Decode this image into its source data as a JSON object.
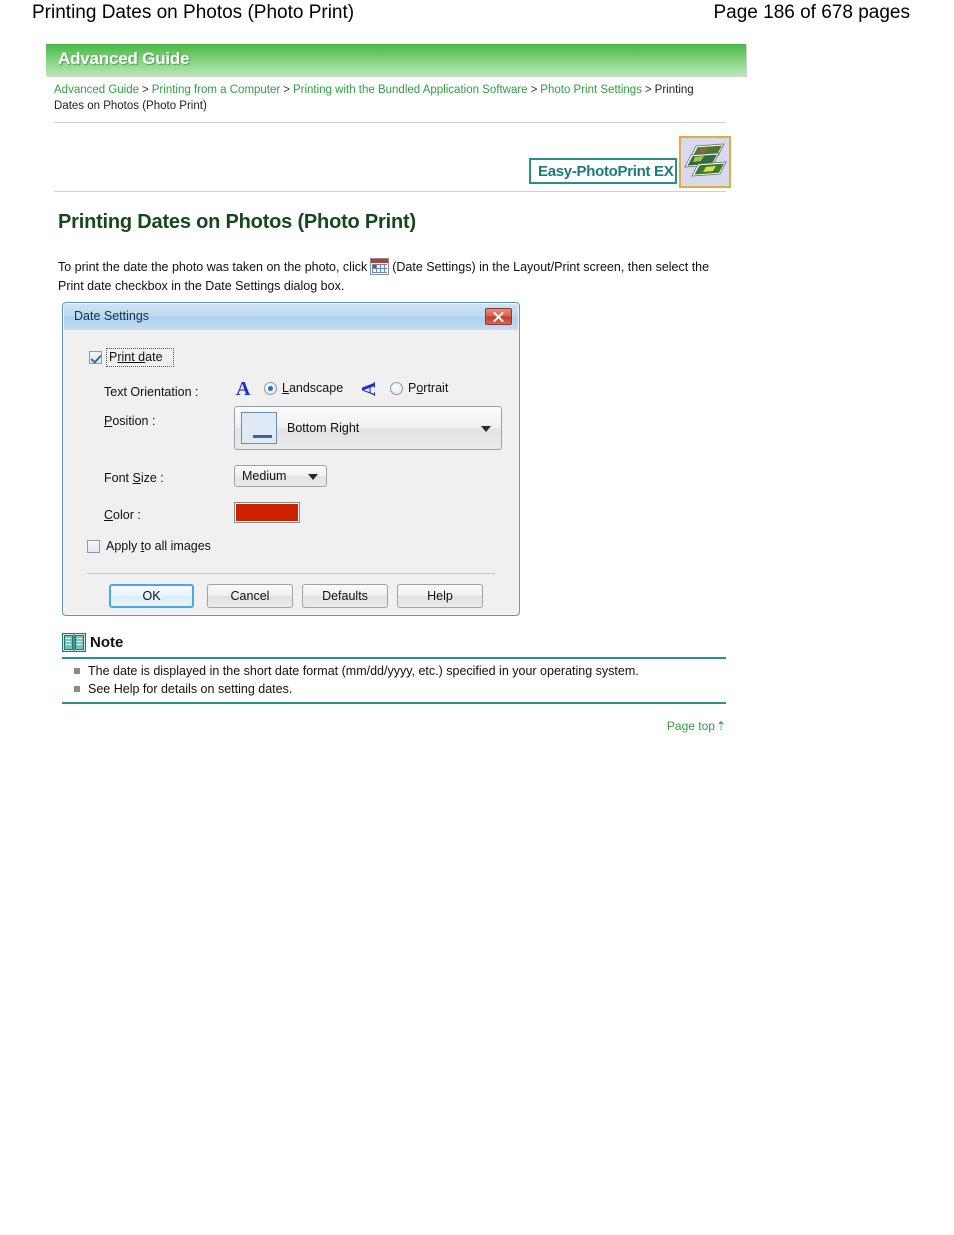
{
  "page": {
    "header_title": "Printing Dates on Photos (Photo Print)",
    "page_indicator": "Page 186 of 678 pages"
  },
  "guide_banner": {
    "label": "Advanced Guide",
    "gradient_top": "#4cb749",
    "gradient_bottom": "#b7e8b3"
  },
  "breadcrumb": {
    "items": [
      {
        "label": "Advanced Guide",
        "link": true
      },
      {
        "label": "Printing from a Computer",
        "link": true
      },
      {
        "label": "Printing with the Bundled Application Software",
        "link": true
      },
      {
        "label": "Photo Print Settings",
        "link": true
      },
      {
        "label": "Printing Dates on Photos (Photo Print)",
        "link": false
      }
    ],
    "separator": ">",
    "link_color": "#2f9e42"
  },
  "product_logo": {
    "badge_text": "Easy-PhotoPrint EX",
    "badge_border_color": "#2b8c8c",
    "badge_text_color": "#1d7a7a",
    "thumbnail_name": "photo-stack-icon",
    "thumbnail_border_color": "#e0ad3c"
  },
  "main": {
    "heading": "Printing Dates on Photos (Photo Print)",
    "heading_color": "#14491b",
    "paragraph_part1": "To print the date the photo was taken on the photo, click",
    "paragraph_icon_name": "date-settings-icon",
    "paragraph_part2": "(Date Settings) in the Layout/Print screen, then select the Print date checkbox in the Date Settings dialog box."
  },
  "dialog": {
    "title": "Date Settings",
    "close_label": "Close",
    "print_date": {
      "label_prefix": "P",
      "label_underline": "rint d",
      "label_suffix": "ate",
      "label_full": "Print date",
      "checked": true
    },
    "text_orientation": {
      "label": "Text Orientation :",
      "landscape": {
        "label": "Landscape",
        "glyph": "A",
        "selected": true
      },
      "portrait": {
        "label": "Portrait",
        "glyph": "A",
        "selected": false
      }
    },
    "position": {
      "label": "Position :",
      "value": "Bottom Right",
      "icon_name": "position-bottom-right-icon"
    },
    "font_size": {
      "label": "Font Size :",
      "value": "Medium"
    },
    "color": {
      "label": "Color :",
      "value": "#cc2200"
    },
    "apply_all": {
      "label": "Apply to all images",
      "checked": false
    },
    "buttons": {
      "ok": "OK",
      "cancel": "Cancel",
      "defaults": "Defaults",
      "help": "Help"
    }
  },
  "note": {
    "title": "Note",
    "icon_name": "open-book-icon",
    "rule_color": "#2f9090",
    "items": [
      "The date is displayed in the short date format (mm/dd/yyyy, etc.) specified in your operating system.",
      "See Help for details on setting dates."
    ]
  },
  "footer": {
    "page_top_label": "Page top",
    "page_top_color": "#2f9e42"
  }
}
